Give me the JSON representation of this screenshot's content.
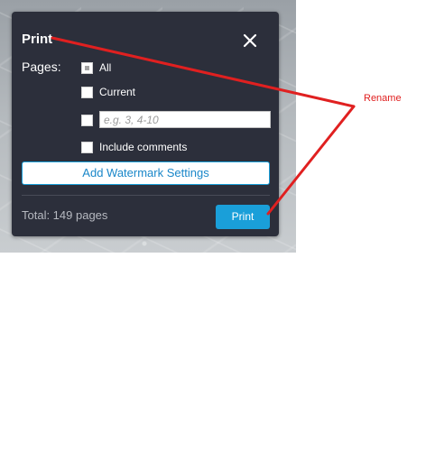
{
  "dialog": {
    "title": "Print",
    "pages_label": "Pages:",
    "options": [
      {
        "label": "All",
        "checked": true
      },
      {
        "label": "Current",
        "checked": false
      },
      {
        "label": "",
        "checked": false
      },
      {
        "label": "Include comments",
        "checked": false
      }
    ],
    "range_input": {
      "value": "",
      "placeholder": "e.g. 3, 4-10"
    },
    "watermark_button": "Add Watermark Settings",
    "total_text": "Total: 149 pages",
    "print_button": "Print"
  },
  "annotation": {
    "label": "Rename",
    "color": "#e02020"
  },
  "colors": {
    "dialog_bg": "#2c2f3b",
    "accent": "#1a9fd9"
  }
}
